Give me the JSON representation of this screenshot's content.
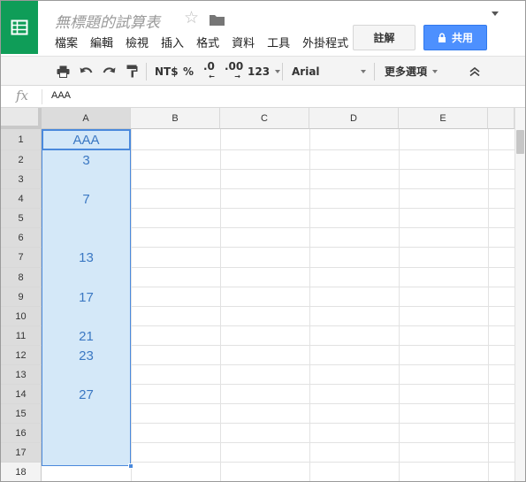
{
  "header": {
    "doc_title": "無標題的試算表",
    "menus": [
      "檔案",
      "編輯",
      "檢視",
      "插入",
      "格式",
      "資料",
      "工具",
      "外掛程式"
    ],
    "comment_label": "註解",
    "share_label": "共用"
  },
  "toolbar": {
    "currency_label": "NT$",
    "percent_label": "%",
    "dec_decrease_label": ".0",
    "dec_increase_label": ".00",
    "number_format_label": "123",
    "font_label": "Arial",
    "more_label": "更多選項"
  },
  "formula_bar": {
    "fx_label": "fx",
    "value": "AAA"
  },
  "grid": {
    "columns": [
      "A",
      "B",
      "C",
      "D",
      "E"
    ],
    "rows": [
      "1",
      "2",
      "3",
      "4",
      "5",
      "6",
      "7",
      "8",
      "9",
      "10",
      "11",
      "12",
      "13",
      "14",
      "15",
      "16",
      "17",
      "18"
    ],
    "column_a_values": [
      "AAA",
      "3",
      "",
      "7",
      "",
      "",
      "13",
      "",
      "17",
      "",
      "21",
      "23",
      "",
      "27",
      "",
      "",
      "",
      ""
    ]
  },
  "colors": {
    "brand": "#0f9d58",
    "share_button": "#4d90fe",
    "selection": "#d4e8f8",
    "selection_border": "#4a89dc",
    "cell_text": "#3b78c3"
  }
}
